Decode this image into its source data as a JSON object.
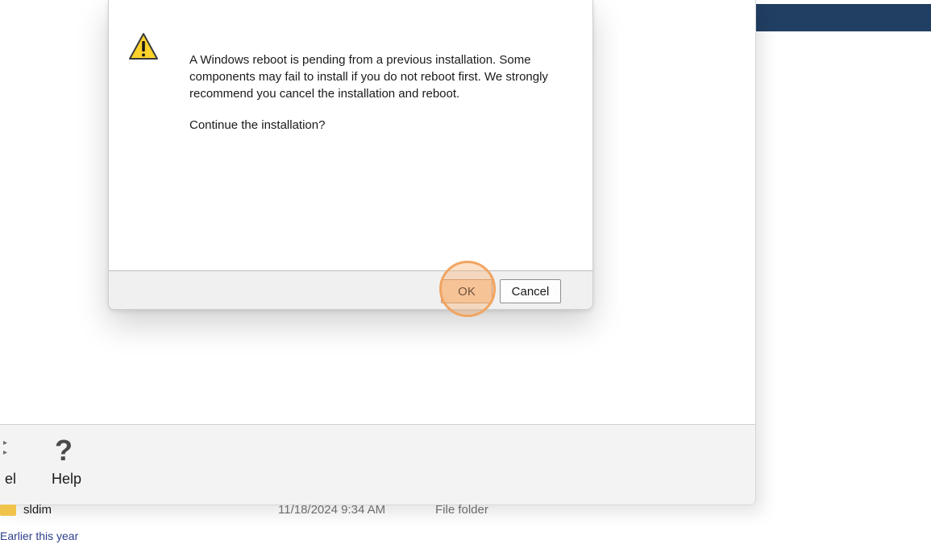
{
  "dialog": {
    "message": "A Windows reboot is pending from a previous installation. Some components may fail to install if you do not reboot first. We strongly recommend you cancel the installation and reboot.",
    "question": "Continue the installation?",
    "buttons": {
      "ok": "OK",
      "cancel": "Cancel"
    },
    "icon": "warning-icon"
  },
  "background_window": {
    "toolbar": {
      "cancel_label_partial": "el",
      "help_label": "Help",
      "help_icon": "?"
    },
    "file_list": {
      "rows": [
        {
          "name": "sldim",
          "date": "11/18/2024 9:34 AM",
          "type": "File folder"
        }
      ],
      "group_header": "Earlier this year"
    }
  },
  "colors": {
    "banner": "#213f63",
    "highlight": "#f1a461",
    "ok_button": "#f5cfb0",
    "group_header": "#2d3f8c"
  }
}
